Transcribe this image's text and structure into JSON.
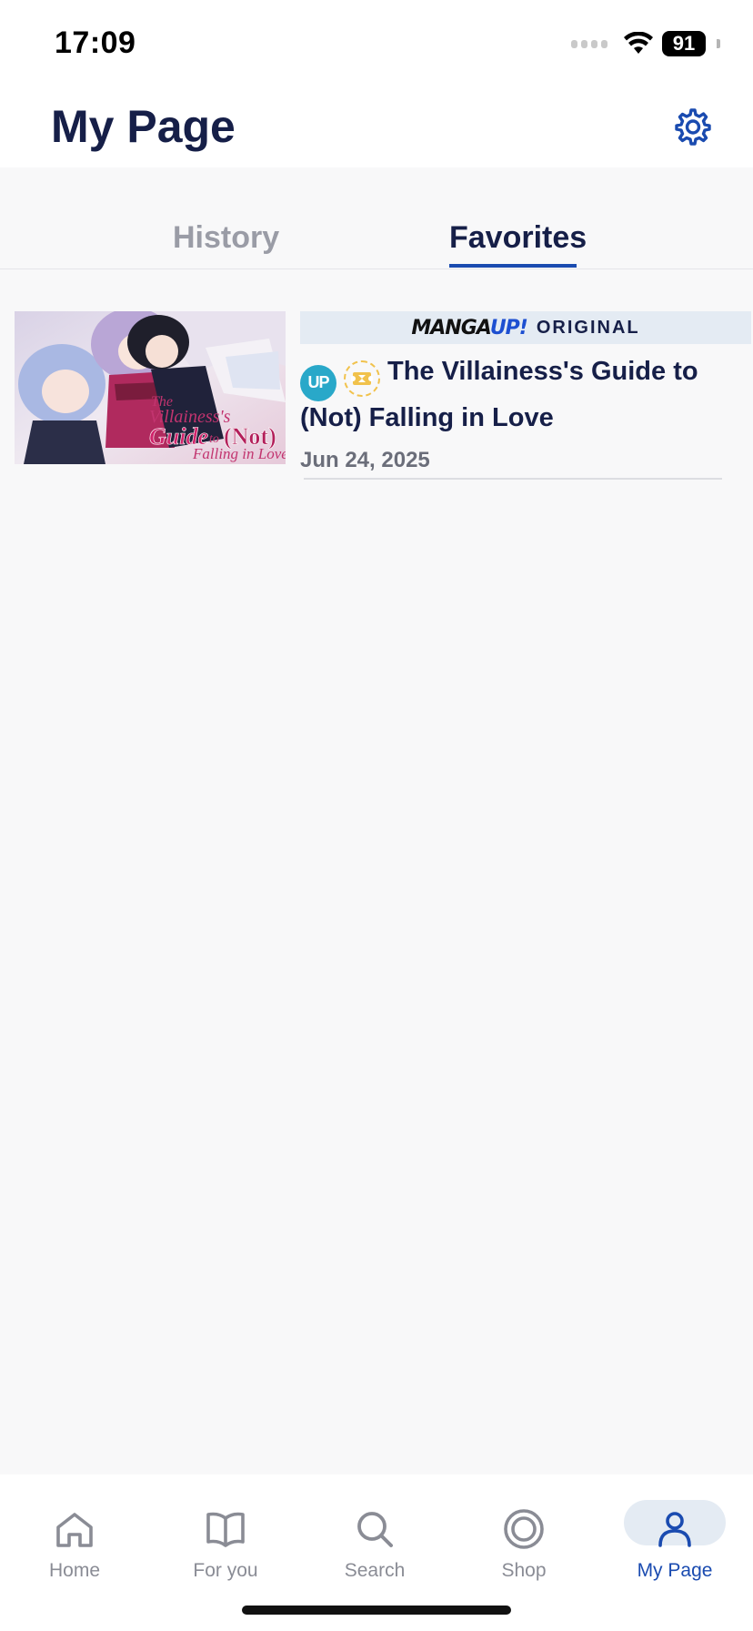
{
  "status_bar": {
    "time": "17:09",
    "battery": "91",
    "icons": [
      "signal-icon",
      "wifi-icon",
      "battery-icon"
    ]
  },
  "header": {
    "title": "My Page",
    "settings_icon": "gear-icon",
    "accent_color": "#1a4bb0"
  },
  "tabs": [
    {
      "label": "History",
      "active": false
    },
    {
      "label": "Favorites",
      "active": true
    }
  ],
  "favorites": [
    {
      "banner_brand_prefix": "MANGA",
      "banner_brand_suffix": "UP!",
      "banner_label": "ORIGINAL",
      "badge_up": "UP",
      "badge_ticket_icon": "ticket-icon",
      "title": "The Villainess's Guide to (Not) Falling in Love",
      "date": "Jun 24, 2025",
      "cover_text_1": "The",
      "cover_text_2": "Villainess's",
      "cover_text_3": "Guide",
      "cover_text_4": "to",
      "cover_text_5": "(Not)",
      "cover_text_6": "Falling in Love"
    }
  ],
  "bottom_nav": [
    {
      "label": "Home",
      "icon": "home-icon",
      "active": false
    },
    {
      "label": "For you",
      "icon": "book-icon",
      "active": false
    },
    {
      "label": "Search",
      "icon": "search-icon",
      "active": false
    },
    {
      "label": "Shop",
      "icon": "shop-coin-icon",
      "active": false
    },
    {
      "label": "My Page",
      "icon": "person-icon",
      "active": true
    }
  ],
  "colors": {
    "primary_text": "#161f48",
    "accent": "#1a4bb0",
    "inactive": "#8a8c95",
    "badge_up": "#29a8c9",
    "badge_ticket": "#f1c24c"
  }
}
